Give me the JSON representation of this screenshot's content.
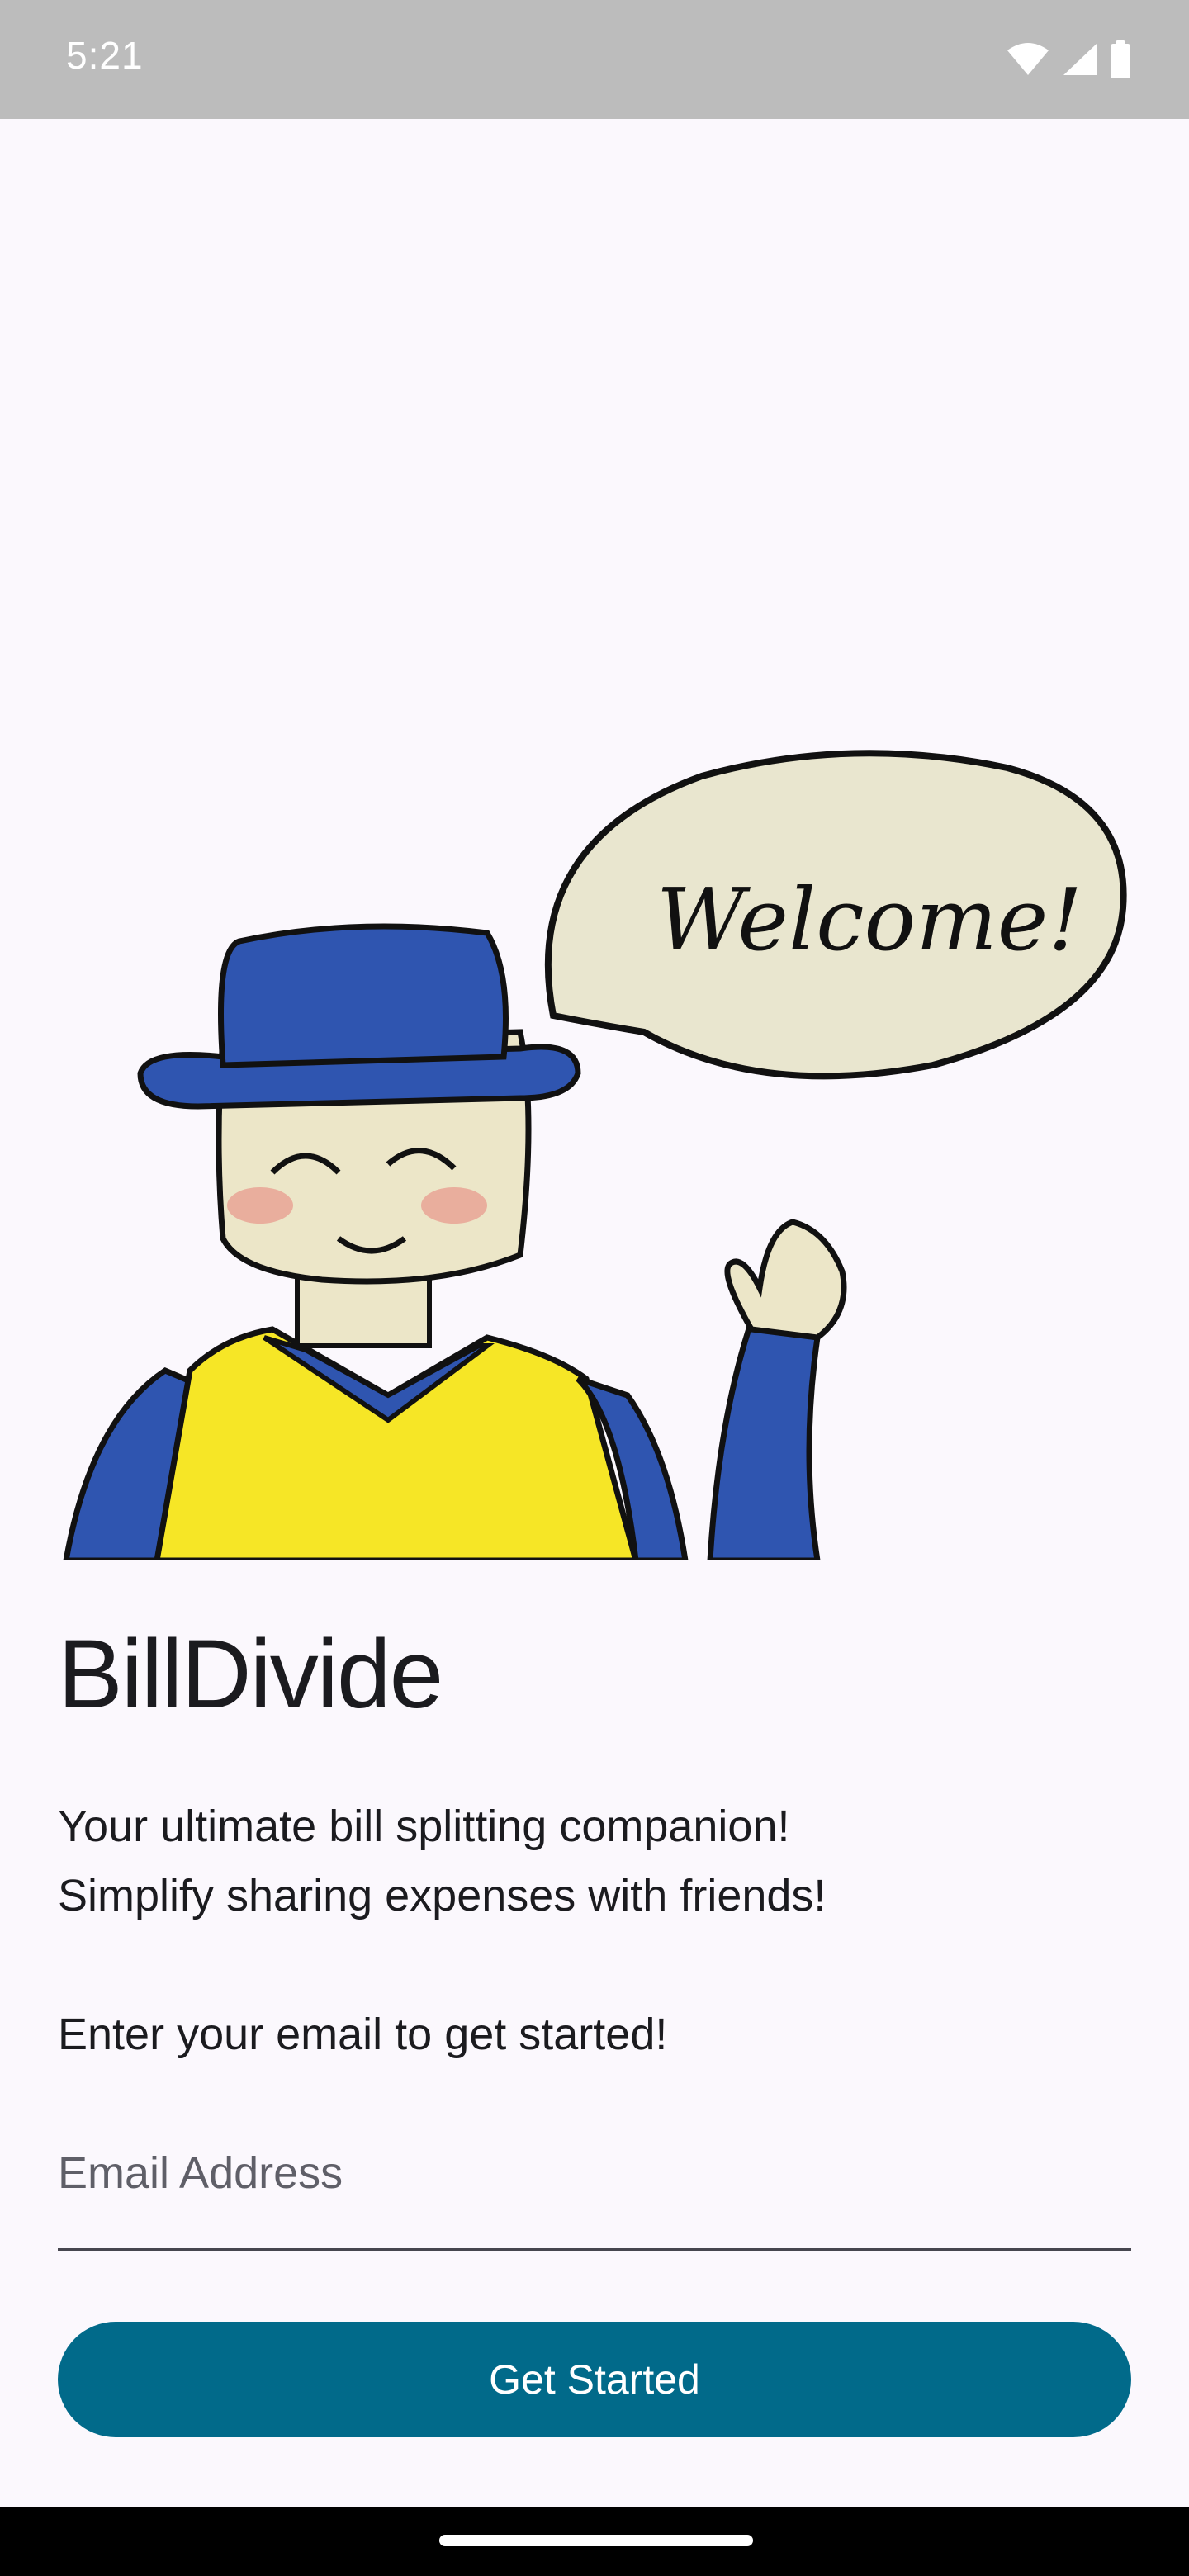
{
  "status_bar": {
    "time": "5:21",
    "icons": [
      "wifi-icon",
      "cell-signal-icon",
      "battery-icon"
    ]
  },
  "illustration": {
    "speech_bubble_text": "Welcome!",
    "description_icon": "waving-character-illustration"
  },
  "app": {
    "title": "BillDivide",
    "tagline_line1": "Your ultimate bill splitting companion!",
    "tagline_line2": "Simplify sharing expenses with friends!",
    "prompt": "Enter your email to get started!"
  },
  "email_field": {
    "placeholder": "Email Address",
    "value": ""
  },
  "actions": {
    "get_started_label": "Get Started"
  },
  "colors": {
    "background": "#fbf8fd",
    "primary": "#016a8a",
    "on_primary": "#ffffff",
    "status_bar": "#bcbcbc",
    "hat_blue": "#2f55b0",
    "shirt_yellow": "#f6e626"
  }
}
